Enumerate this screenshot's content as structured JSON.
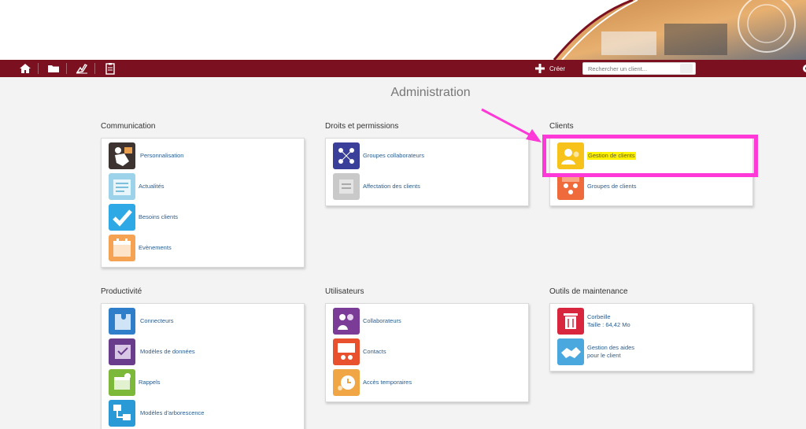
{
  "toolbar": {
    "create_label": "Créer",
    "search_placeholder": "Rechercher un client..."
  },
  "page": {
    "title": "Administration"
  },
  "sections": {
    "communication": {
      "title": "Communication",
      "items": [
        "Personnalisation",
        "Actualités",
        "Besoins clients",
        "Evènements"
      ]
    },
    "droits": {
      "title": "Droits et permissions",
      "items": [
        "Groupes collaborateurs",
        "Affectation des clients"
      ]
    },
    "clients": {
      "title": "Clients",
      "items": [
        "Gestion de clients",
        "Groupes de clients"
      ]
    },
    "productivite": {
      "title": "Productivité",
      "items": [
        "Connecteurs",
        "Modèles de données",
        "Rappels",
        "Modèles d'arborescence"
      ]
    },
    "utilisateurs": {
      "title": "Utilisateurs",
      "items": [
        "Collaborateurs",
        "Contacts",
        "Accès temporaires"
      ]
    },
    "maintenance": {
      "title": "Outils de maintenance",
      "corbeille_name": "Corbeille",
      "corbeille_size": "Taille : 64,42 Mo",
      "aides_line1": "Gestion des aides",
      "aides_line2": "pour le client"
    }
  },
  "colors": {
    "toolbar": "#7a1020",
    "link": "#2a5d8f",
    "highlight_box": "#ff38d8",
    "highlight_text": "#fff200"
  }
}
